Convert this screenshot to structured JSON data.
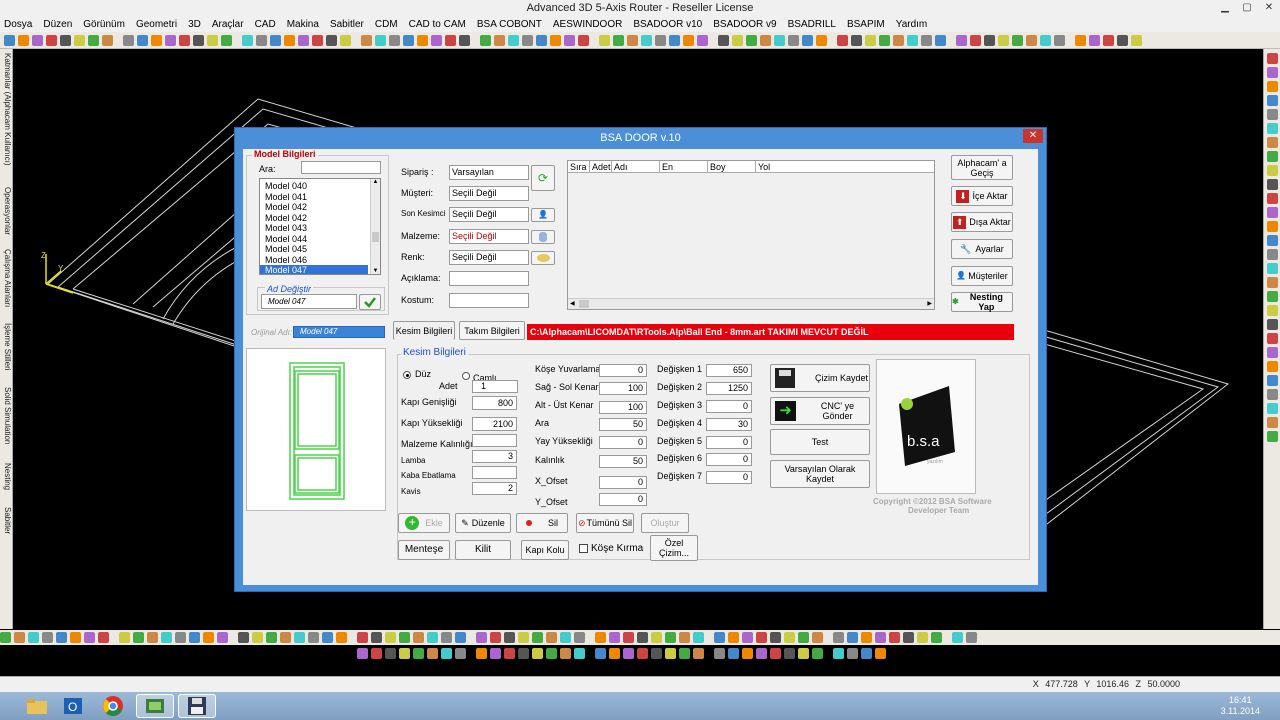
{
  "window": {
    "title": "Advanced 3D 5-Axis Router - Reseller License"
  },
  "menu": [
    "Dosya",
    "Düzen",
    "Görünüm",
    "Geometri",
    "3D",
    "Araçlar",
    "CAD",
    "Makina",
    "Sabitler",
    "CDM",
    "CAD to CAM",
    "BSA COBONT",
    "AESWINDOOR",
    "BSADOOR v10",
    "BSADOOR v9",
    "BSADRILL",
    "BSAPIM",
    "Yardım"
  ],
  "left_tabs": [
    "Katmanlar (Alphacam Kullanıcı)",
    "Operasyonlar",
    "Çalışma Alanları",
    "İşleme Stilleri",
    "Solid Simulation",
    "Nesting",
    "Sabitler"
  ],
  "status": {
    "x": "X 477.728",
    "y": "Y 1016.46",
    "z": "Z 50.0000"
  },
  "clock": {
    "time": "16:41",
    "date": "3.11.2014"
  },
  "dialog": {
    "title": "BSA DOOR v.10",
    "close": "✕",
    "model_group_title": "Model Bilgileri",
    "search_label": "Ara:",
    "search_value": "",
    "models": [
      "Model 040",
      "Model 041",
      "Model 042",
      "Model 042",
      "Model 043",
      "Model 044",
      "Model 045",
      "Model 046",
      "Model 047"
    ],
    "selected_model": "Model 047",
    "rename_title": "Ad Değiştir",
    "rename_value": "Model 047",
    "original_label": "Orijinal Adı:",
    "original_value": "Model 047",
    "order": {
      "siparis_label": "Sipariş :",
      "siparis_value": "Varsayılan",
      "musteri_label": "Müşteri:",
      "musteri_value": "Seçili Değil",
      "kesimci_label": "Son Kesimci",
      "kesimci_value": "Seçili Değil",
      "malzeme_label": "Malzeme:",
      "malzeme_value": "Seçili Değil",
      "renk_label": "Renk:",
      "renk_value": "Seçili Değil",
      "aciklama_label": "Açıklama:",
      "aciklama_value": "",
      "kostum_label": "Kostum:",
      "kostum_value": ""
    },
    "table_headers": [
      "Sıra",
      "Adet",
      "Adı",
      "En",
      "Boy",
      "Yol"
    ],
    "right_buttons": [
      "Alphacam' a Geçiş",
      "İçe Aktar",
      "Dışa Aktar",
      "Ayarlar",
      "Müşteriler",
      "Nesting Yap"
    ],
    "tabs": [
      "Kesim Bilgileri",
      "Takım Bilgileri"
    ],
    "warning": "C:\\Alphacam\\LICOMDAT\\RTools.Alp\\Ball End - 8mm.art TAKIMI MEVCUT DEĞİL",
    "kesim": {
      "title": "Kesim Bilgileri",
      "duz": "Düz",
      "camli": "Camlı",
      "adet_label": "Adet",
      "adet": "1",
      "genislik_label": "Kapı Genişliği",
      "genislik": "800",
      "yukseklik_label": "Kapı Yüksekliği",
      "yukseklik": "2100",
      "kalinlik_label": "Malzeme Kalınlığı",
      "kalinlik": "",
      "lamba_label": "Lamba",
      "lamba": "3",
      "kaba_label": "Kaba Ebatlama",
      "kaba": "",
      "kavis_label": "Kavis",
      "kavis": "2",
      "kose_label": "Köşe Yuvarlama",
      "kose": "0",
      "sagsol_label": "Sağ - Sol Kenar",
      "sagsol": "100",
      "altust_label": "Alt - Üst Kenar",
      "altust": "100",
      "ara_label": "Ara",
      "ara": "50",
      "yay_label": "Yay Yüksekliği",
      "yay": "0",
      "kalinlik2_label": "Kalınlık",
      "kalinlik2": "50",
      "xofset_label": "X_Ofset",
      "xofset": "0",
      "yofset_label": "Y_Ofset",
      "yofset": "0",
      "d1_label": "Değişken 1",
      "d1": "650",
      "d2_label": "Değişken 2",
      "d2": "1250",
      "d3_label": "Değişken 3",
      "d3": "0",
      "d4_label": "Değişken 4",
      "d4": "30",
      "d5_label": "Değişken 5",
      "d5": "0",
      "d6_label": "Değişken 6",
      "d6": "0",
      "d7_label": "Değişken 7",
      "d7": "0"
    },
    "action_buttons": {
      "ekle": "Ekle",
      "duzenle": "Düzenle",
      "sil": "Sil",
      "tumunu_sil": "Tümünü Sil",
      "olustur": "Oluştur",
      "mentese": "Menteşe",
      "kilit": "Kilit",
      "kapi_kolu": "Kapı Kolu",
      "kose_kirma": "Köşe Kırma",
      "ozel_cizim": "Özel Çizim..."
    },
    "side_buttons": {
      "cizim_kaydet": "Çizim Kaydet",
      "cnc_gonder": "CNC' ye Gönder",
      "test": "Test",
      "varsayilan": "Varsayılan Olarak Kaydet"
    },
    "logo_text": "b.s.a",
    "logo_sub": "yazılım",
    "copyright": "Copyright ©2012 BSA Software",
    "copyright2": "Developer Team"
  },
  "colors": {
    "accent": "#3372d8",
    "warning_bg": "#e8000b",
    "title_blue": "#4a8fd8"
  }
}
